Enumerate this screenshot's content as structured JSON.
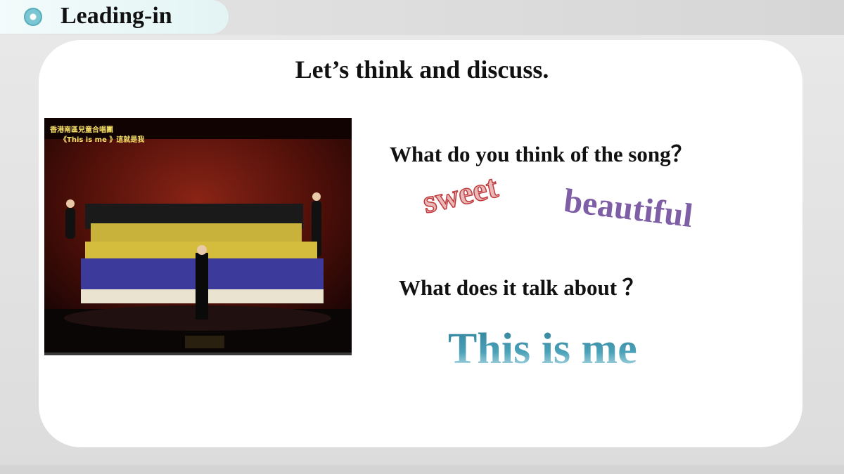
{
  "header": {
    "section_title": "Leading-in"
  },
  "main": {
    "heading": "Let’s think and discuss.",
    "video": {
      "caption_line1": "香港南區兒童合唱團",
      "caption_line2": "《This is me 》這就是我"
    },
    "question1": "What do you think of the song？",
    "word1": "sweet",
    "word2": "beautiful",
    "question2": "What does it talk about ？",
    "answer": "This is me"
  },
  "colors": {
    "sweet": "#c0393b",
    "beautiful": "#7e5fa5",
    "answer": "#3f8ea6",
    "accent": "#7ac6d3"
  }
}
